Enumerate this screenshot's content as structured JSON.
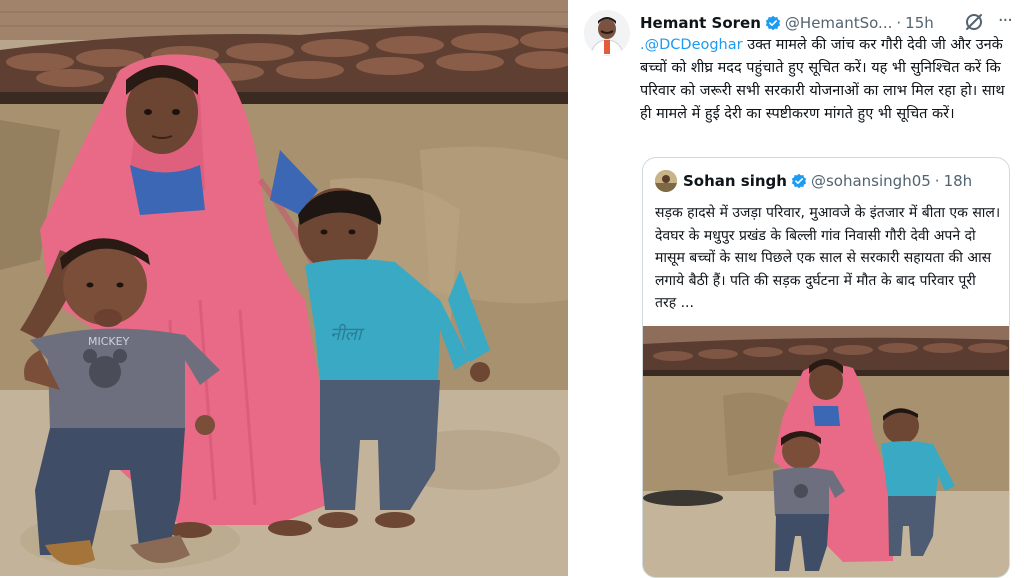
{
  "post": {
    "author_name": "Hemant Soren",
    "author_handle": "@HemantSo...",
    "separator": "·",
    "time": "15h",
    "more_label": "···",
    "mention": ".@DCDeoghar",
    "text": " उक्त मामले की जांच कर गौरी देवी जी और उनके बच्चों को शीघ्र मदद पहुंचाते हुए सूचित करें। यह भी सुनिश्चित करें कि परिवार को जरूरी सभी सरकारी योजनाओं का लाभ मिल रहा हो। साथ ही मामले में हुई देरी का स्पष्टीकरण मांगते हुए भी सूचित करें।"
  },
  "quoted": {
    "author_name": "Sohan singh",
    "author_handle": "@sohansingh05",
    "separator": "·",
    "time": "18h",
    "text": "सड़क हादसे में उजड़ा परिवार, मुआवजे के इंतजार में बीता एक साल। देवघर के मधुपुर प्रखंड के बिल्ली गांव निवासी गौरी देवी अपने दो मासूम बच्चों के साथ पिछले एक साल से सरकारी सहायता की आस लगाये बैठी हैं। पति की सड़क दुर्घटना में मौत के बाद परिवार पूरी तरह ..."
  },
  "photo": {
    "shirt_print": "MICKEY"
  },
  "icons": {
    "verified": "verified-badge-icon",
    "grok": "grok-icon",
    "more": "more-icon"
  },
  "colors": {
    "verified_blue": "#1d9bf0",
    "text": "#0f1419",
    "secondary": "#536471",
    "border": "#cfd9de",
    "saree_pink": "#e86a86",
    "tshirt_teal": "#3aa9c4"
  }
}
